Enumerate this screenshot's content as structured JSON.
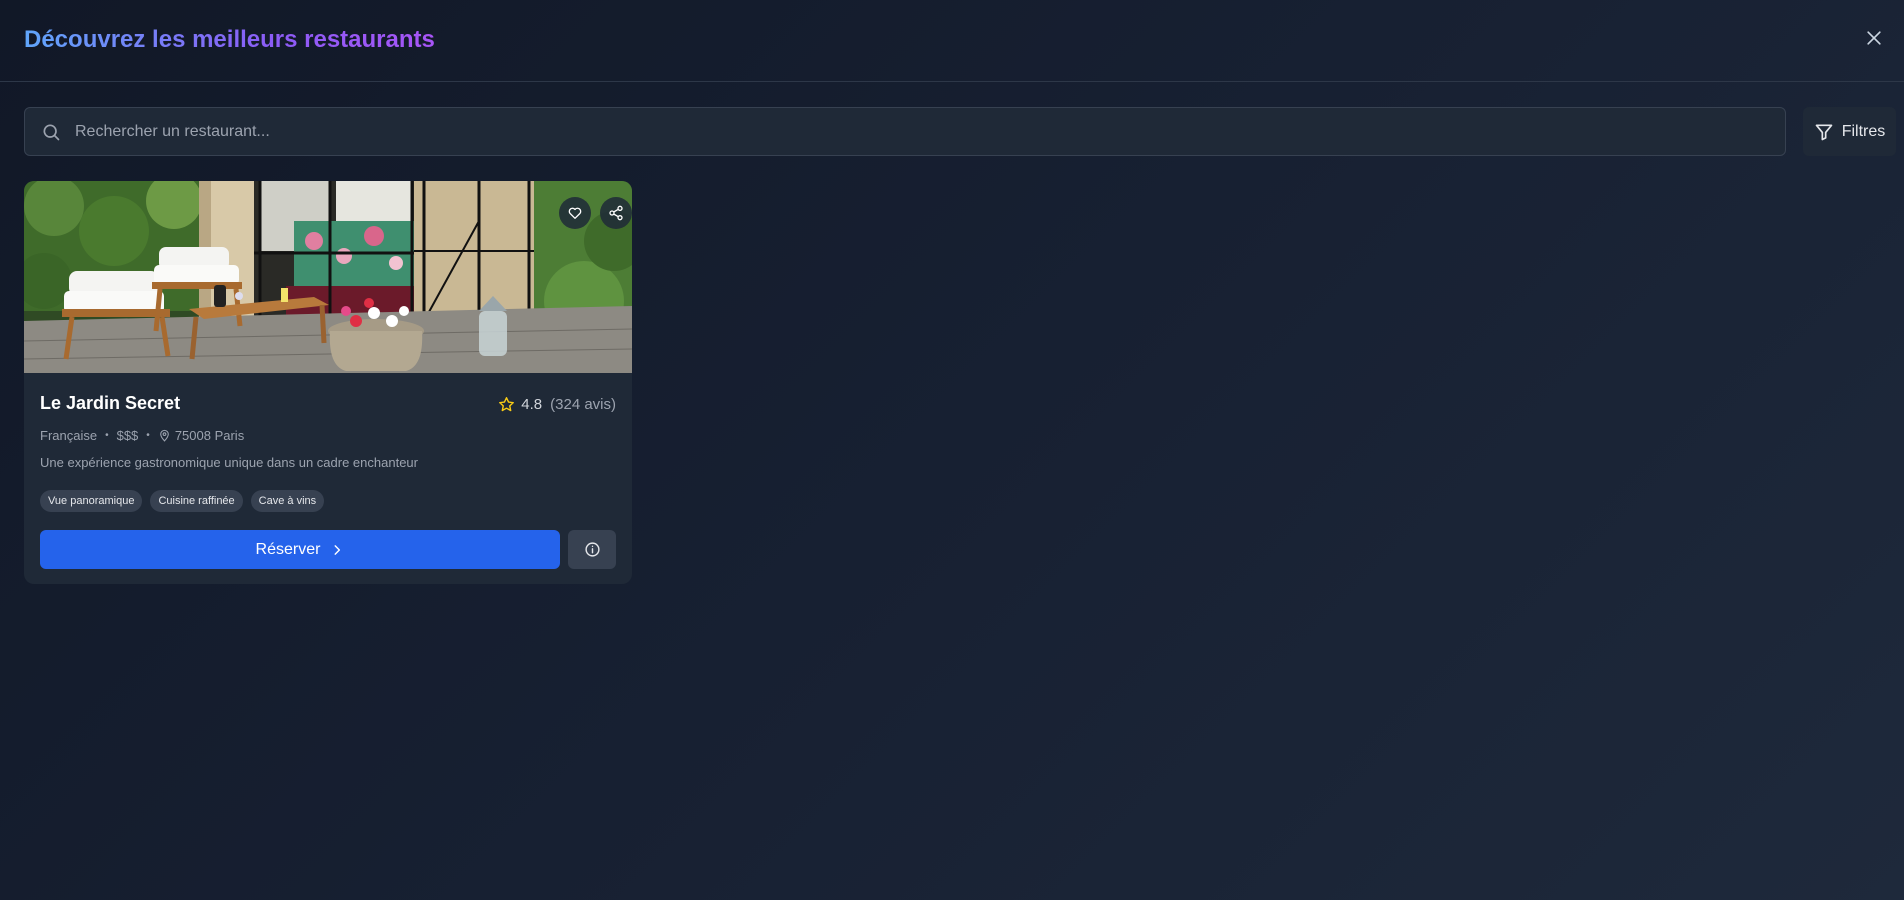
{
  "header": {
    "title": "Découvrez les meilleurs restaurants"
  },
  "search": {
    "placeholder": "Rechercher un restaurant..."
  },
  "filters": {
    "label": "Filtres"
  },
  "restaurants": [
    {
      "name": "Le Jardin Secret",
      "rating": "4.8",
      "reviews": "(324 avis)",
      "cuisine": "Française",
      "price": "$$$",
      "location": "75008 Paris",
      "description": "Une expérience gastronomique unique dans un cadre enchanteur",
      "tags": [
        "Vue panoramique",
        "Cuisine raffinée",
        "Cave à vins"
      ],
      "reserve_label": "Réserver"
    }
  ],
  "separator": "•",
  "icons": {
    "close": "close-icon",
    "search": "search-icon",
    "filter": "filter-icon",
    "favorite": "heart-icon",
    "share": "share-icon",
    "star": "star-icon",
    "location": "map-pin-icon",
    "chevron": "chevron-right-icon",
    "info": "info-icon"
  },
  "colors": {
    "accent": "#2563eb",
    "star": "#facc15",
    "title_gradient_start": "#60a5fa",
    "title_gradient_end": "#a855f7",
    "card_background": "#1f2937"
  }
}
